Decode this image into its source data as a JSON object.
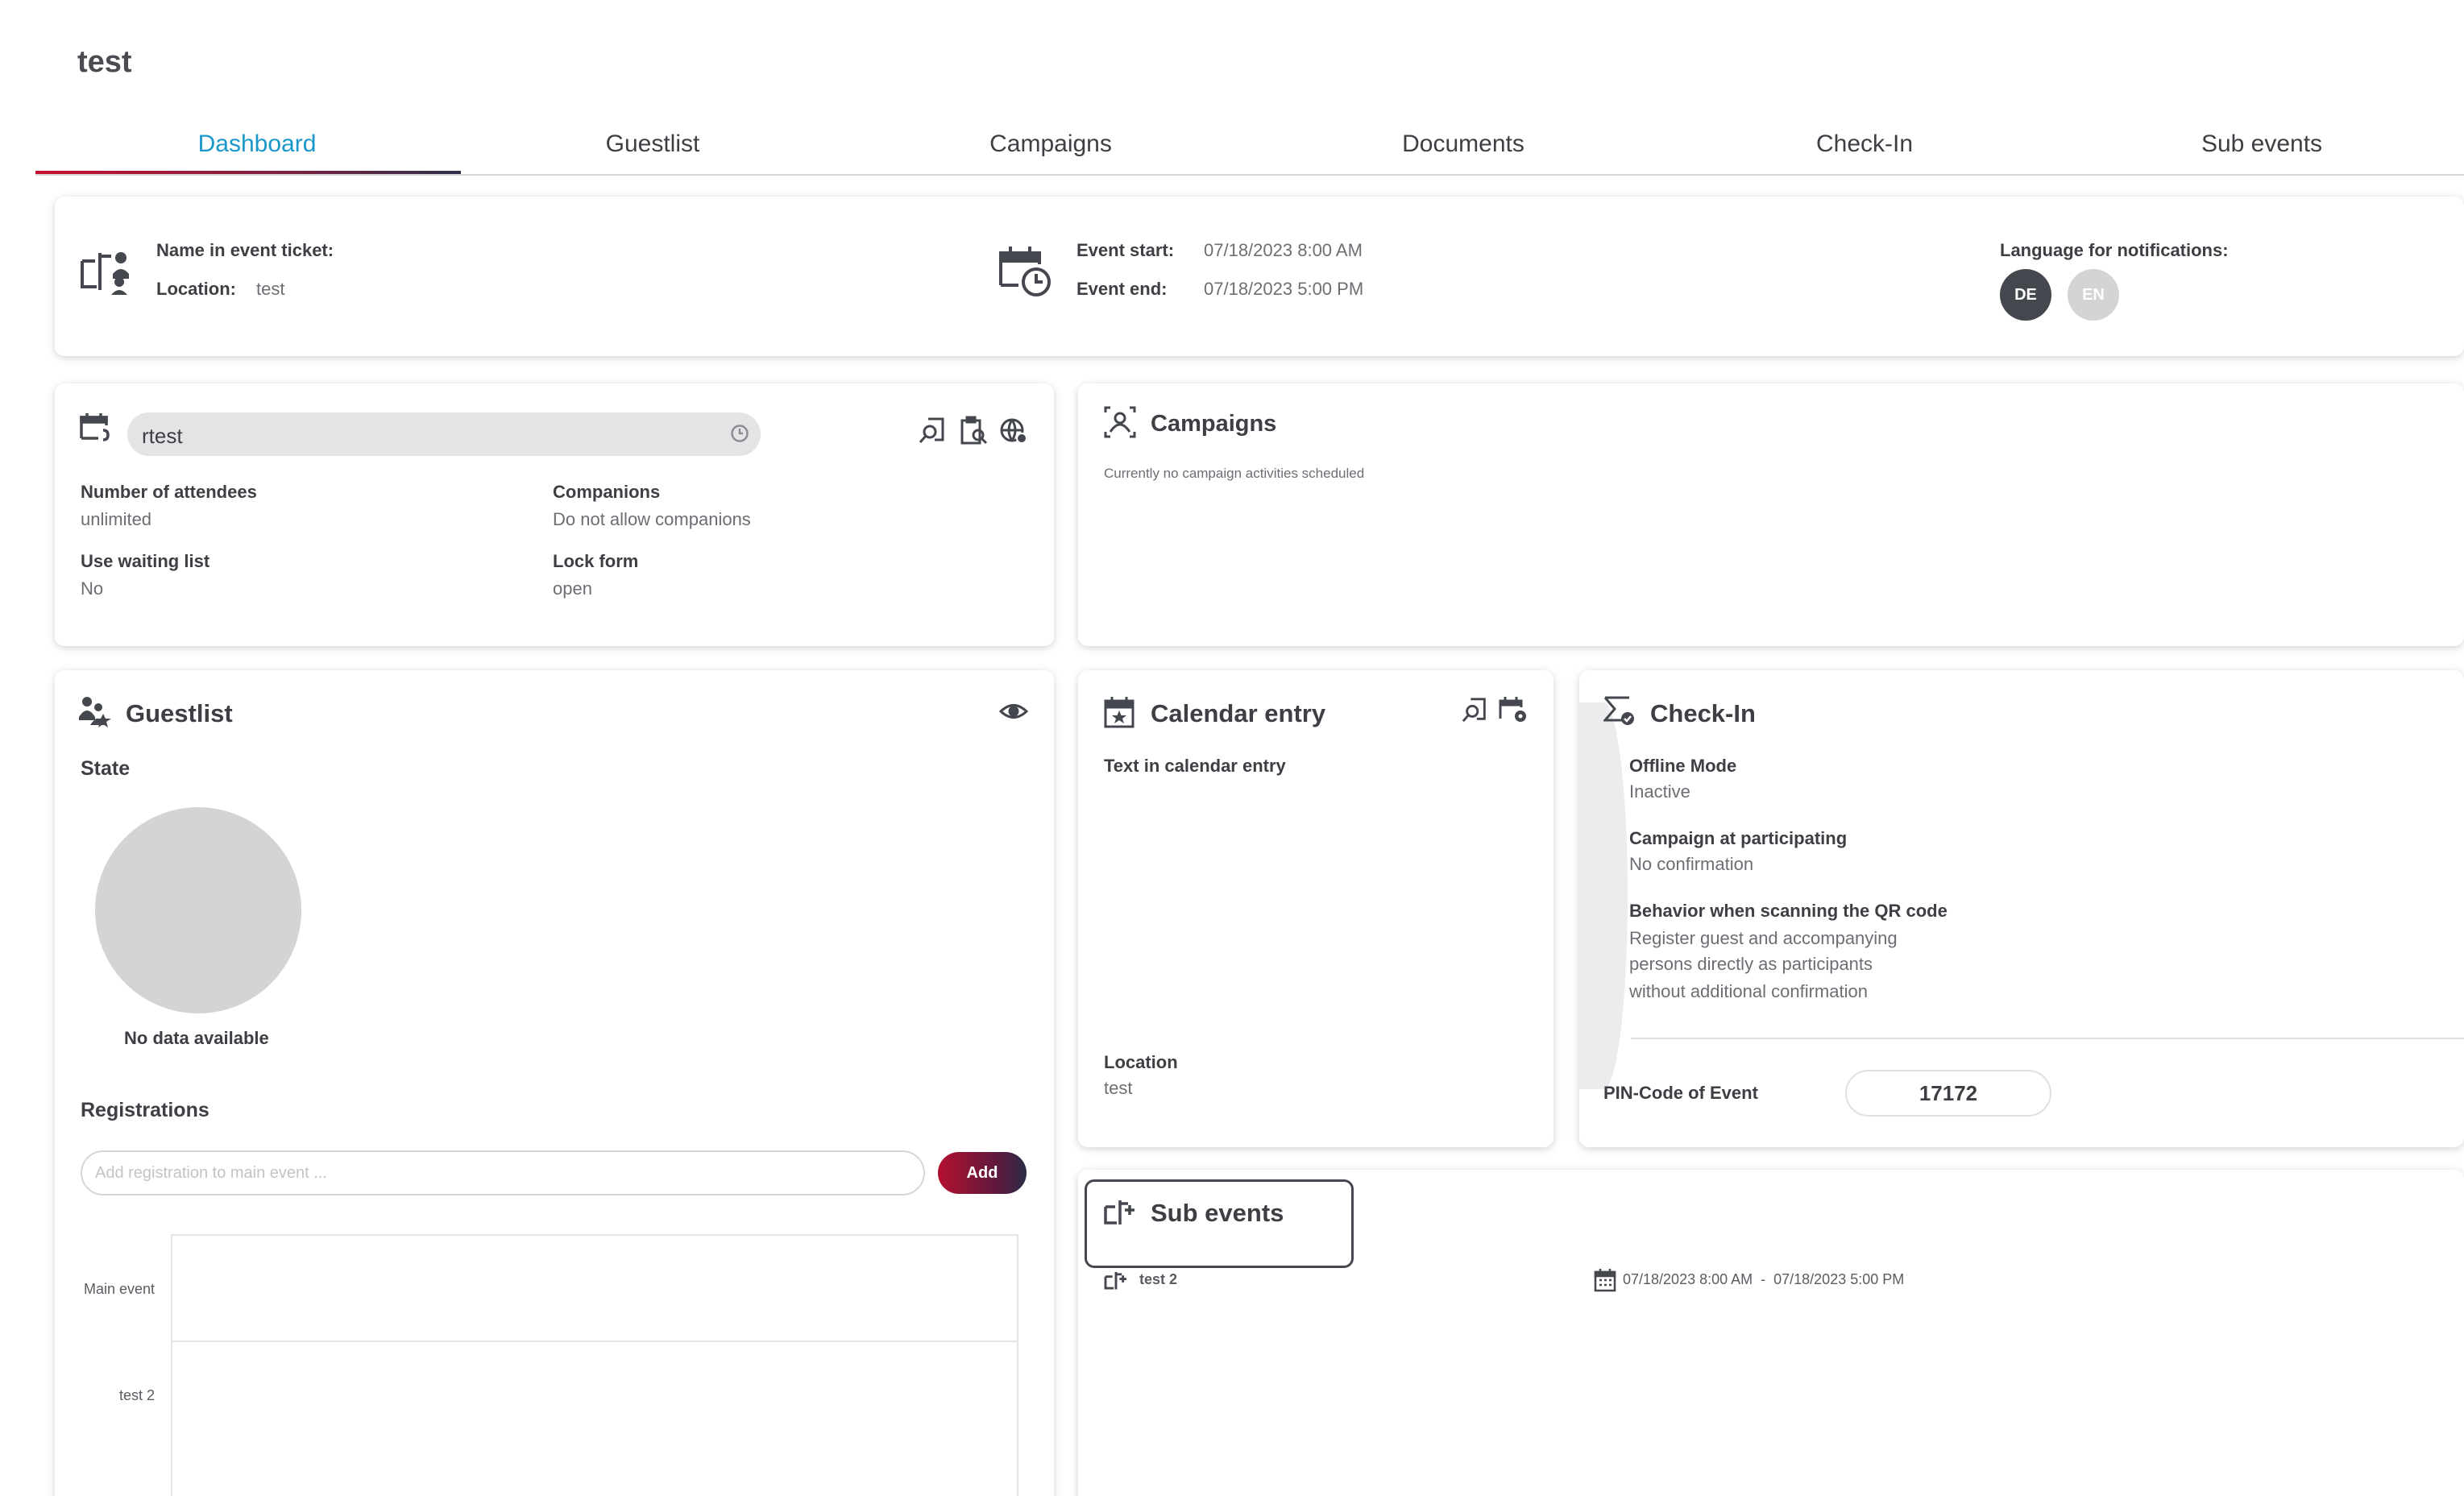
{
  "page": {
    "title": "test"
  },
  "tabs": [
    {
      "label": "Dashboard",
      "active": true
    },
    {
      "label": "Guestlist"
    },
    {
      "label": "Campaigns"
    },
    {
      "label": "Documents"
    },
    {
      "label": "Check-In"
    },
    {
      "label": "Sub events"
    }
  ],
  "overview": {
    "name_label": "Name in event ticket:",
    "location_label": "Location:",
    "location_value": "test",
    "start_label": "Event start:",
    "start_value": "07/18/2023  8:00 AM",
    "end_label": "Event end:",
    "end_value": "07/18/2023  5:00 PM",
    "language_label": "Language for notifications:",
    "languages": [
      {
        "code": "DE",
        "selected": true,
        "color": "#44474e"
      },
      {
        "code": "EN",
        "selected": false,
        "color": "#d4d4d6"
      }
    ]
  },
  "settings": {
    "search_value": "rtest",
    "attendees_label": "Number of attendees",
    "attendees_value": "unlimited",
    "companions_label": "Companions",
    "companions_value": "Do not allow companions",
    "waiting_label": "Use waiting list",
    "waiting_value": "No",
    "lock_label": "Lock form",
    "lock_value": "open"
  },
  "campaigns": {
    "title": "Campaigns",
    "empty_text": "Currently no campaign activities scheduled"
  },
  "guestlist": {
    "title": "Guestlist",
    "state_label": "State",
    "no_data": "No data available",
    "registrations_label": "Registrations",
    "input_placeholder": "Add registration to main event ...",
    "add_label": "Add",
    "rows": [
      "Main event",
      "test 2"
    ]
  },
  "calendar": {
    "title": "Calendar entry",
    "text_label": "Text in calendar entry",
    "location_label": "Location",
    "location_value": "test"
  },
  "checkin": {
    "title": "Check-In",
    "offline_label": "Offline Mode",
    "offline_value": "Inactive",
    "campaign_label": "Campaign at participating",
    "campaign_value": "No confirmation",
    "behavior_label": "Behavior when scanning the QR code",
    "behavior_line1": "Register guest and accompanying",
    "behavior_line2": "persons directly as participants",
    "behavior_line3": "without additional confirmation",
    "pin_label": "PIN-Code of Event",
    "pin_value": "17172"
  },
  "subevents": {
    "title": "Sub events",
    "items": [
      {
        "name": "test 2",
        "range": "07/18/2023 8:00 AM  -  07/18/2023 5:00 PM"
      }
    ]
  },
  "colors": {
    "accent": "#1a97c9",
    "brand_red": "#b3102e",
    "text": "#3d3f44",
    "muted": "#6c6e74"
  }
}
